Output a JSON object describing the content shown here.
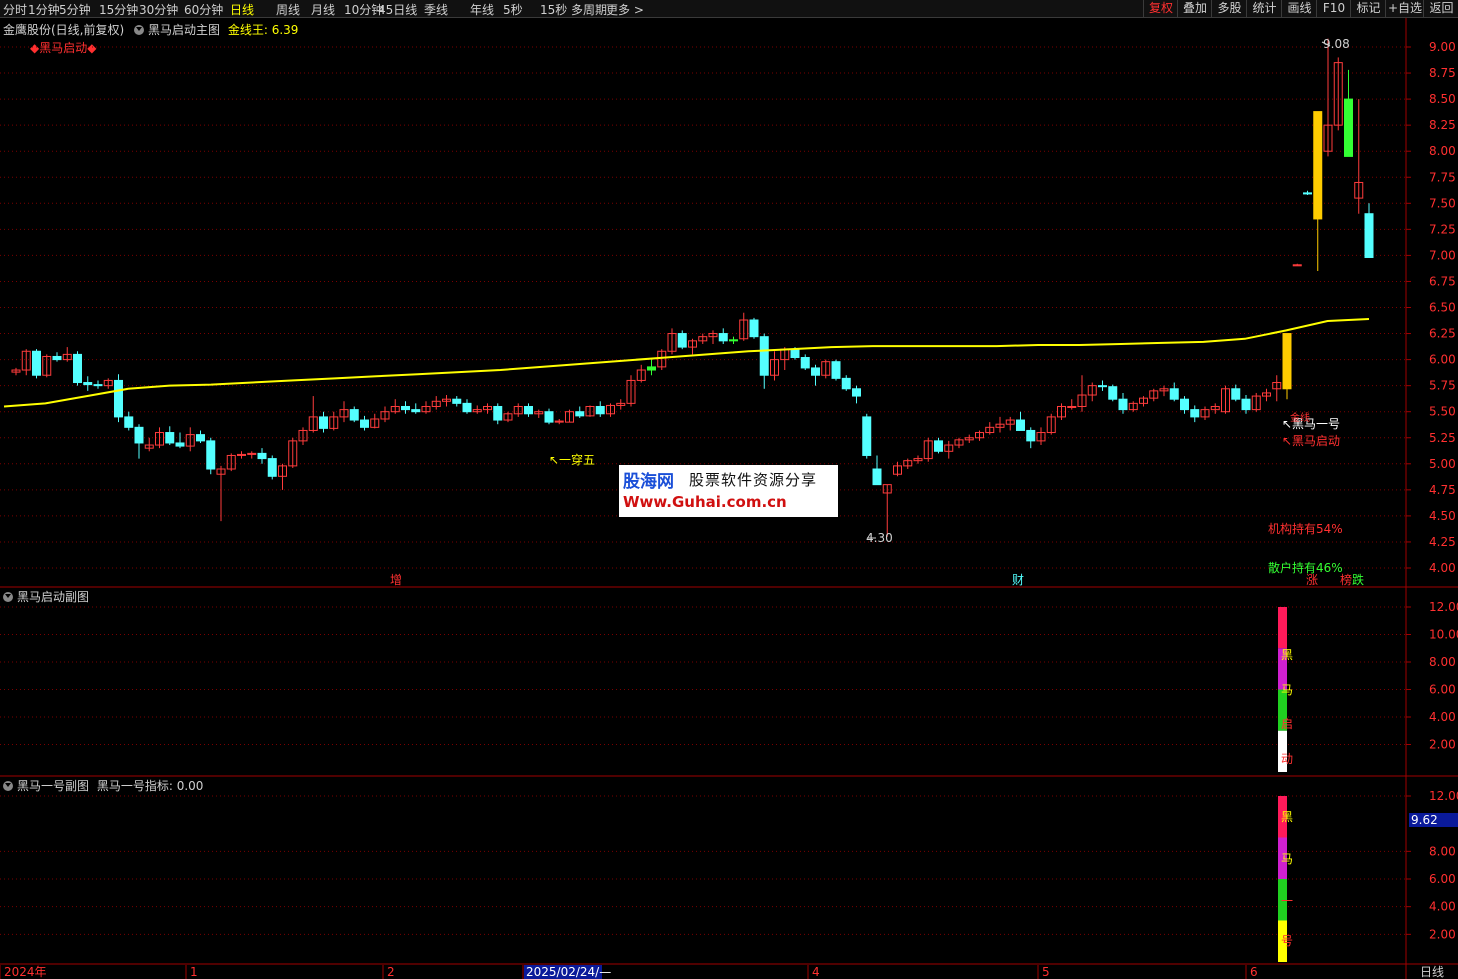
{
  "toolbar": {
    "tabs": [
      "分时",
      "1分钟",
      "5分钟",
      "15分钟",
      "30分钟",
      "60分钟",
      "日线",
      "周线",
      "月线",
      "10分钟",
      "45日线",
      "季线",
      "年线",
      "5秒",
      "15秒",
      "多周期",
      "更多 >"
    ],
    "active_tab": "日线",
    "right_buttons": [
      "复权",
      "叠加",
      "多股",
      "统计",
      "画线",
      "F10",
      "标记",
      "+自选",
      "返回"
    ],
    "active_right": "复权"
  },
  "main_panel": {
    "stock": "金鹰股份(日线,前复权)",
    "indicator": "黑马启动主图",
    "ma_label": "金线王: 6.39",
    "signal_title": "◆黑马启动◆",
    "annotations": {
      "high": "9.08",
      "low": "4.30",
      "yichuanwu": "↖一穿五",
      "heima1": "↖黑马一号",
      "heima_start": "↖黑马启动",
      "jinxian": "金线",
      "inst_hold": "机构持有54%",
      "retail_hold": "散户持有46%",
      "tag_zeng": "增",
      "tag_cai": "财",
      "tag_zhang": "涨",
      "tag_bang": "榜",
      "tag_die": "跌"
    },
    "y_ticks": [
      "9.00",
      "8.75",
      "8.50",
      "8.25",
      "8.00",
      "7.75",
      "7.50",
      "7.25",
      "7.00",
      "6.75",
      "6.50",
      "6.25",
      "6.00",
      "5.75",
      "5.50",
      "5.25",
      "5.00",
      "4.75",
      "4.50",
      "4.25",
      "4.00"
    ]
  },
  "sub_panel1": {
    "title": "黑马启动副图",
    "y_ticks": [
      "12.00",
      "10.00",
      "8.00",
      "6.00",
      "4.00",
      "2.00"
    ],
    "bar_chars": [
      "黑",
      "马",
      "启",
      "动"
    ]
  },
  "sub_panel2": {
    "title": "黑马一号副图",
    "value_label": "黑马一号指标: 0.00",
    "y_ticks": [
      "12.00",
      "8.00",
      "6.00",
      "4.00",
      "2.00"
    ],
    "cursor_value": "9.62",
    "bar_chars": [
      "黑",
      "马",
      "一",
      "号"
    ]
  },
  "x_axis": {
    "labels": [
      "2024年",
      "1",
      "2",
      "2025/02/24/—",
      "4",
      "5",
      "6"
    ],
    "period": "日线"
  },
  "watermark": {
    "brand": "股海网",
    "slogan": "股票软件资源分享",
    "url": "Www.Guhai.com.cn"
  },
  "colors": {
    "up": "#ff3c3c",
    "down": "#54ffff",
    "ma": "#ffff00",
    "grid": "#7a0000"
  },
  "chart_data": {
    "type": "candlestick",
    "price_range": [
      4.0,
      9.1
    ],
    "ma_name": "金线王",
    "ma_last": 6.39,
    "candles": [
      [
        5.88,
        5.92,
        5.85,
        5.9
      ],
      [
        5.9,
        6.1,
        5.85,
        6.08
      ],
      [
        6.08,
        6.1,
        5.82,
        5.85
      ],
      [
        5.85,
        6.05,
        5.83,
        6.03
      ],
      [
        6.03,
        6.07,
        5.98,
        6.0
      ],
      [
        6.0,
        6.12,
        5.98,
        6.05
      ],
      [
        6.05,
        6.08,
        5.75,
        5.78
      ],
      [
        5.78,
        5.84,
        5.7,
        5.76
      ],
      [
        5.76,
        5.8,
        5.72,
        5.75
      ],
      [
        5.75,
        5.82,
        5.72,
        5.8
      ],
      [
        5.8,
        5.86,
        5.4,
        5.45
      ],
      [
        5.45,
        5.5,
        5.32,
        5.35
      ],
      [
        5.35,
        5.38,
        5.05,
        5.2
      ],
      [
        5.15,
        5.25,
        5.12,
        5.18
      ],
      [
        5.18,
        5.35,
        5.15,
        5.3
      ],
      [
        5.3,
        5.36,
        5.18,
        5.2
      ],
      [
        5.2,
        5.3,
        5.15,
        5.17
      ],
      [
        5.17,
        5.35,
        5.12,
        5.28
      ],
      [
        5.28,
        5.32,
        5.2,
        5.22
      ],
      [
        5.22,
        5.25,
        4.9,
        4.95
      ],
      [
        4.9,
        4.98,
        4.45,
        4.95
      ],
      [
        4.95,
        5.1,
        4.93,
        5.08
      ],
      [
        5.08,
        5.12,
        5.05,
        5.09
      ],
      [
        5.09,
        5.12,
        5.05,
        5.1
      ],
      [
        5.1,
        5.15,
        5.0,
        5.05
      ],
      [
        5.05,
        5.08,
        4.85,
        4.88
      ],
      [
        4.88,
        5.0,
        4.75,
        4.98
      ],
      [
        4.98,
        5.25,
        4.96,
        5.22
      ],
      [
        5.22,
        5.35,
        5.18,
        5.32
      ],
      [
        5.32,
        5.65,
        5.3,
        5.45
      ],
      [
        5.45,
        5.5,
        5.3,
        5.34
      ],
      [
        5.34,
        5.5,
        5.32,
        5.45
      ],
      [
        5.45,
        5.6,
        5.4,
        5.52
      ],
      [
        5.52,
        5.55,
        5.4,
        5.42
      ],
      [
        5.42,
        5.46,
        5.32,
        5.35
      ],
      [
        5.35,
        5.48,
        5.34,
        5.43
      ],
      [
        5.43,
        5.55,
        5.4,
        5.5
      ],
      [
        5.5,
        5.62,
        5.48,
        5.55
      ],
      [
        5.55,
        5.6,
        5.48,
        5.52
      ],
      [
        5.52,
        5.58,
        5.48,
        5.5
      ],
      [
        5.5,
        5.6,
        5.48,
        5.55
      ],
      [
        5.55,
        5.65,
        5.52,
        5.6
      ],
      [
        5.6,
        5.66,
        5.55,
        5.62
      ],
      [
        5.62,
        5.65,
        5.55,
        5.58
      ],
      [
        5.58,
        5.62,
        5.48,
        5.5
      ],
      [
        5.5,
        5.56,
        5.48,
        5.52
      ],
      [
        5.52,
        5.58,
        5.48,
        5.55
      ],
      [
        5.55,
        5.58,
        5.38,
        5.42
      ],
      [
        5.42,
        5.5,
        5.4,
        5.48
      ],
      [
        5.48,
        5.58,
        5.45,
        5.55
      ],
      [
        5.55,
        5.58,
        5.45,
        5.48
      ],
      [
        5.48,
        5.52,
        5.44,
        5.5
      ],
      [
        5.5,
        5.53,
        5.38,
        5.4
      ],
      [
        5.4,
        5.43,
        5.38,
        5.41
      ],
      [
        5.4,
        5.52,
        5.4,
        5.5
      ],
      [
        5.5,
        5.55,
        5.44,
        5.46
      ],
      [
        5.46,
        5.56,
        5.45,
        5.55
      ],
      [
        5.55,
        5.6,
        5.45,
        5.48
      ],
      [
        5.48,
        5.58,
        5.45,
        5.56
      ],
      [
        5.56,
        5.62,
        5.52,
        5.58
      ],
      [
        5.58,
        5.85,
        5.55,
        5.8
      ],
      [
        5.8,
        5.95,
        5.78,
        5.9
      ],
      [
        5.9,
        6.0,
        5.85,
        5.93
      ],
      [
        5.93,
        6.1,
        5.9,
        6.08
      ],
      [
        6.08,
        6.3,
        6.05,
        6.25
      ],
      [
        6.25,
        6.28,
        6.1,
        6.12
      ],
      [
        6.12,
        6.2,
        6.05,
        6.18
      ],
      [
        6.18,
        6.25,
        6.15,
        6.22
      ],
      [
        6.22,
        6.28,
        6.15,
        6.25
      ],
      [
        6.25,
        6.3,
        6.15,
        6.18
      ],
      [
        6.18,
        6.22,
        6.15,
        6.19
      ],
      [
        6.2,
        6.45,
        6.18,
        6.38
      ],
      [
        6.38,
        6.4,
        6.2,
        6.22
      ],
      [
        6.22,
        6.25,
        5.72,
        5.85
      ],
      [
        5.85,
        6.08,
        5.8,
        6.0
      ],
      [
        6.0,
        6.12,
        5.9,
        6.1
      ],
      [
        6.1,
        6.12,
        6.0,
        6.02
      ],
      [
        6.02,
        6.05,
        5.9,
        5.92
      ],
      [
        5.92,
        5.95,
        5.75,
        5.85
      ],
      [
        5.85,
        6.0,
        5.82,
        5.98
      ],
      [
        5.98,
        6.0,
        5.8,
        5.82
      ],
      [
        5.82,
        5.85,
        5.7,
        5.72
      ],
      [
        5.72,
        5.75,
        5.58,
        5.65
      ],
      [
        5.45,
        5.48,
        5.05,
        5.08
      ],
      [
        4.95,
        5.08,
        4.8,
        4.8
      ],
      [
        4.72,
        4.8,
        4.3,
        4.8
      ],
      [
        4.9,
        5.02,
        4.88,
        4.98
      ],
      [
        4.98,
        5.05,
        4.95,
        5.03
      ],
      [
        5.03,
        5.08,
        5.0,
        5.05
      ],
      [
        5.05,
        5.25,
        5.02,
        5.22
      ],
      [
        5.22,
        5.25,
        5.1,
        5.12
      ],
      [
        5.12,
        5.22,
        5.05,
        5.18
      ],
      [
        5.18,
        5.25,
        5.15,
        5.23
      ],
      [
        5.23,
        5.28,
        5.2,
        5.25
      ],
      [
        5.25,
        5.32,
        5.22,
        5.3
      ],
      [
        5.3,
        5.4,
        5.28,
        5.35
      ],
      [
        5.35,
        5.45,
        5.3,
        5.38
      ],
      [
        5.38,
        5.45,
        5.32,
        5.42
      ],
      [
        5.42,
        5.5,
        5.38,
        5.32
      ],
      [
        5.32,
        5.35,
        5.15,
        5.22
      ],
      [
        5.22,
        5.35,
        5.18,
        5.3
      ],
      [
        5.3,
        5.48,
        5.28,
        5.45
      ],
      [
        5.45,
        5.58,
        5.42,
        5.55
      ],
      [
        5.55,
        5.62,
        5.52,
        5.55
      ],
      [
        5.55,
        5.85,
        5.5,
        5.66
      ],
      [
        5.66,
        5.78,
        5.6,
        5.75
      ],
      [
        5.75,
        5.8,
        5.7,
        5.74
      ],
      [
        5.74,
        5.76,
        5.6,
        5.62
      ],
      [
        5.62,
        5.68,
        5.48,
        5.52
      ],
      [
        5.52,
        5.6,
        5.5,
        5.58
      ],
      [
        5.58,
        5.65,
        5.55,
        5.63
      ],
      [
        5.63,
        5.72,
        5.6,
        5.7
      ],
      [
        5.7,
        5.75,
        5.65,
        5.72
      ],
      [
        5.72,
        5.78,
        5.6,
        5.62
      ],
      [
        5.62,
        5.65,
        5.48,
        5.52
      ],
      [
        5.52,
        5.56,
        5.4,
        5.45
      ],
      [
        5.45,
        5.55,
        5.42,
        5.52
      ],
      [
        5.52,
        5.58,
        5.48,
        5.55
      ],
      [
        5.5,
        5.75,
        5.48,
        5.72
      ],
      [
        5.72,
        5.76,
        5.6,
        5.62
      ],
      [
        5.62,
        5.66,
        5.48,
        5.52
      ],
      [
        5.52,
        5.68,
        5.5,
        5.65
      ],
      [
        5.65,
        5.72,
        5.6,
        5.68
      ],
      [
        5.72,
        5.85,
        5.6,
        5.78
      ],
      [
        5.72,
        6.25,
        5.62,
        6.25
      ],
      [
        6.9,
        6.92,
        6.9,
        6.91
      ],
      [
        7.6,
        7.62,
        7.58,
        7.59
      ],
      [
        7.35,
        8.38,
        6.85,
        8.38
      ],
      [
        8.0,
        9.08,
        7.95,
        8.25
      ],
      [
        8.25,
        8.9,
        8.2,
        8.85
      ],
      [
        8.5,
        8.78,
        7.95,
        7.95
      ],
      [
        7.55,
        8.5,
        7.4,
        7.7
      ],
      [
        7.4,
        7.5,
        6.98,
        6.98
      ]
    ],
    "ma_points": [
      5.55,
      5.58,
      5.65,
      5.72,
      5.75,
      5.76,
      5.78,
      5.8,
      5.82,
      5.84,
      5.86,
      5.88,
      5.9,
      5.93,
      5.96,
      5.99,
      6.02,
      6.05,
      6.08,
      6.1,
      6.12,
      6.13,
      6.13,
      6.13,
      6.13,
      6.14,
      6.14,
      6.15,
      6.16,
      6.17,
      6.2,
      6.28,
      6.37,
      6.39
    ]
  }
}
